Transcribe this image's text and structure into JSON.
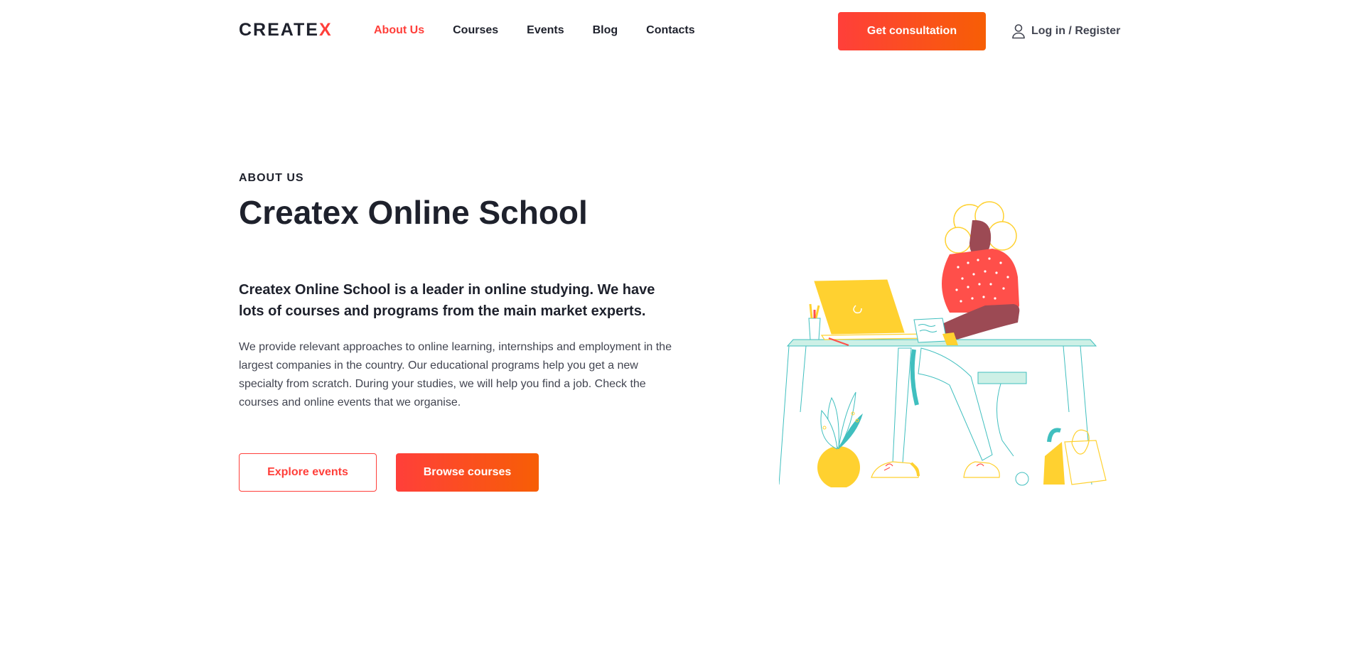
{
  "header": {
    "logo": {
      "text": "CREATE",
      "accent": "X"
    },
    "nav": [
      {
        "label": "About Us",
        "active": true
      },
      {
        "label": "Courses",
        "active": false
      },
      {
        "label": "Events",
        "active": false
      },
      {
        "label": "Blog",
        "active": false
      },
      {
        "label": "Contacts",
        "active": false
      }
    ],
    "consult_label": "Get consultation",
    "login_label": "Log in / Register",
    "login_icon": "user-icon"
  },
  "hero": {
    "eyebrow": "ABOUT US",
    "title": "Createx Online School",
    "lead": "Createx Online School is a leader in online studying. We have lots of courses and programs from the main market experts.",
    "body": "We provide relevant approaches to online learning, internships and employment in the largest companies in the country. Our educational programs help you get a new specialty from scratch. During your studies, we will help you find a job. Check the courses and online events that we organise.",
    "explore_label": "Explore events",
    "browse_label": "Browse courses"
  },
  "colors": {
    "accent": "#ff3f3a",
    "accent_gradient_end": "#f75e05",
    "text_dark": "#1e212c",
    "text_body": "#424551",
    "illustration_yellow": "#ffd130",
    "illustration_teal": "#40bfbf",
    "illustration_mint": "#cdf0e6",
    "illustration_red": "#ff4f4a",
    "illustration_skin": "#9c4a54"
  }
}
